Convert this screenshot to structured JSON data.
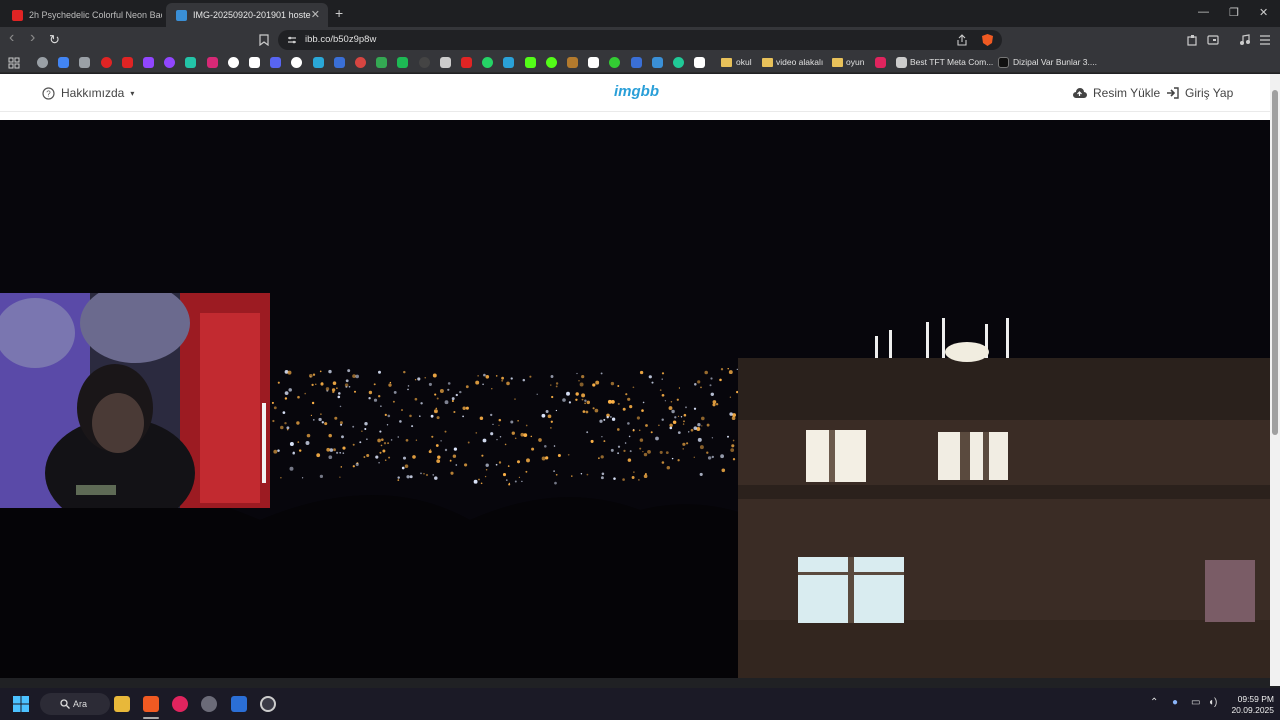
{
  "tabs": [
    {
      "title": "2h Psychedelic Colorful Neon Backg...",
      "favicon_color": "#e02424",
      "active": false
    },
    {
      "title": "IMG-20250920-201901 hosted a...",
      "favicon_color": "#3a8fd6",
      "active": true
    }
  ],
  "tab_close": "✕",
  "new_tab": "+",
  "window": {
    "minimize": "—",
    "restore": "❐",
    "close": "✕"
  },
  "toolbar": {
    "back": "‹",
    "forward": "›",
    "reload": "↻",
    "url": "ibb.co/b50z9p8w"
  },
  "bookmarks": {
    "folders": [
      "okul",
      "video alakalı",
      "oyun"
    ],
    "items": [
      "Best TFT Meta Com...",
      "Dizipal Var Bunlar 3...."
    ],
    "icon_colors": [
      "#9aa0a6",
      "#4285f4",
      "#9aa0a6",
      "#e02424",
      "#e02424",
      "#9146ff",
      "#9146ff",
      "#23c4a8",
      "#d62976",
      "#ffffff",
      "#ffffff",
      "#5865f2",
      "#ffffff",
      "#2aa8d8",
      "#3a6fd6",
      "#d64541",
      "#34a853",
      "#1db954",
      "#444",
      "#cccccc",
      "#e02424",
      "#25d366",
      "#2aa1d8",
      "#53fc18",
      "#53fc18",
      "#b37a2d",
      "#ffffff",
      "#33cc33",
      "#3a6fd6",
      "#3a8fd6",
      "#20c997",
      "#ffffff"
    ]
  },
  "site": {
    "about": "Hakkımızda",
    "logo": "imgbb",
    "upload": "Resim Yükle",
    "login": "Giriş Yap"
  },
  "taskbar": {
    "search": "Ara",
    "time": "09:59 PM",
    "date": "20.09.2025"
  },
  "colors": {
    "accent": "#2a9fd8",
    "brand_logo": "#2a9fd8"
  }
}
